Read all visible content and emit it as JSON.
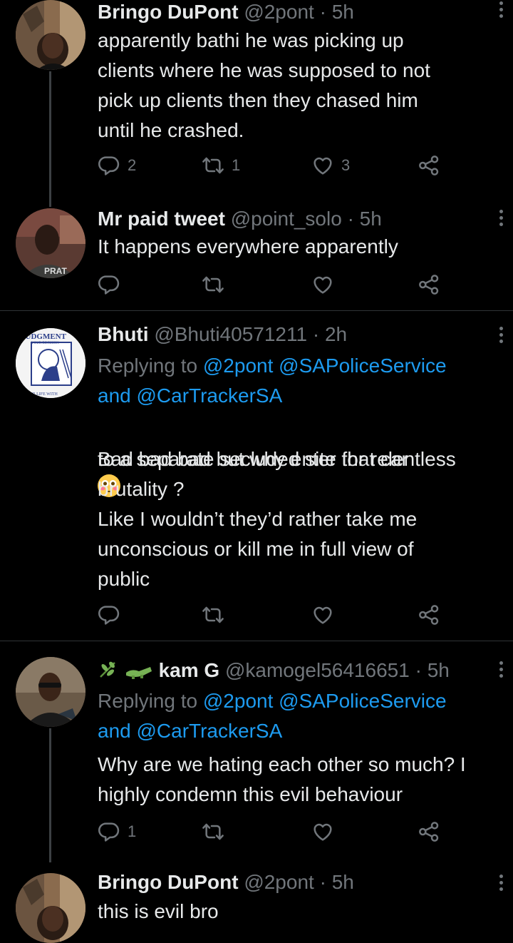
{
  "tweets": [
    {
      "name": "Bringo DuPont",
      "handle": "@2pont",
      "dot": "·",
      "time": "5h",
      "text": "apparently bathi he was picking up\nclients where he was supposed to not\npick up clients then they chased him\nuntil he crashed.",
      "replies": "2",
      "retweets": "1",
      "likes": "3"
    },
    {
      "name": "Mr paid tweet",
      "handle": "@point_solo",
      "dot": "·",
      "time": "5h",
      "text": "It happens everywhere apparently",
      "replies": "",
      "retweets": "",
      "likes": ""
    },
    {
      "name": "Bhuti",
      "handle": "@Bhuti40571211",
      "dot": "·",
      "time": "2h",
      "replying_prefix": "Replying to",
      "reply_link1": "@2pont",
      "reply_link2": "@SAPoliceService",
      "reply_and": "and",
      "reply_link3": "@CarTrackerSA",
      "text_line1": "Bad bad bad  but why enter that car",
      "emoji": "flushed-face",
      "text_rest": "to a separate secluded site for relentless\nbrutality ?\nLike I wouldn’t they’d rather take me\nunconscious or kill me in full view of\npublic",
      "avatar_text_top": "JUDGMENT",
      "avatar_text_sub": "YOUR DECISION",
      "avatar_text_bottom": "IS YOUR LIFE WITH"
    },
    {
      "name_emoji_1": "herb",
      "name_emoji_2": "crocodile",
      "name": "kam G",
      "handle": "@kamogel56416651",
      "dot": "·",
      "time": "5h",
      "replying_prefix": "Replying to",
      "reply_link1": "@2pont",
      "reply_link2": "@SAPoliceService",
      "reply_and": "and",
      "reply_link3": "@CarTrackerSA",
      "text": "Why are we hating each other so much? I\nhighly condemn this evil behaviour",
      "replies": "1"
    },
    {
      "name": "Bringo DuPont",
      "handle": "@2pont",
      "dot": "·",
      "time": "5h",
      "text": "this is evil bro"
    }
  ],
  "colors": {
    "background": "#000000",
    "text": "#e7e9ea",
    "muted": "#71767b",
    "link": "#1d9bf0",
    "divider": "#2f3336"
  }
}
